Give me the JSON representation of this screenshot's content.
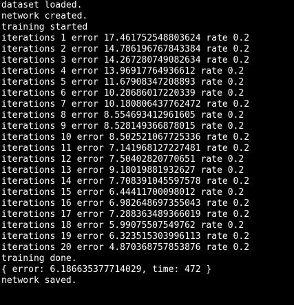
{
  "terminal": {
    "background": "#000000",
    "foreground": "#ffffff",
    "lines": [
      "dataset loaded.",
      "network created.",
      "training started",
      "iterations 1 error 17.461752548803624 rate 0.2",
      "iterations 2 error 14.786196767843384 rate 0.2",
      "iterations 3 error 14.267280749082634 rate 0.2",
      "iterations 4 error 13.96917764936612 rate 0.2",
      "iterations 5 error 11.67908347208893 rate 0.2",
      "iterations 6 error 10.28686017220339 rate 0.2",
      "iterations 7 error 10.180806437762472 rate 0.2",
      "iterations 8 error 8.554693412961605 rate 0.2",
      "iterations 9 error 8.528149366878015 rate 0.2",
      "iterations 10 error 8.502521067725336 rate 0.2",
      "iterations 11 error 7.141968127227481 rate 0.2",
      "iterations 12 error 7.50402820770651 rate 0.2",
      "iterations 13 error 9.18019881932627 rate 0.2",
      "iterations 14 error 7.708391045597578 rate 0.2",
      "iterations 15 error 6.44411700098012 rate 0.2",
      "iterations 16 error 6.982648697355043 rate 0.2",
      "iterations 17 error 7.288363489366019 rate 0.2",
      "iterations 18 error 5.99075507549762 rate 0.2",
      "iterations 19 error 6.323515303996113 rate 0.2",
      "iterations 20 error 4.870368757853876 rate 0.2",
      "training done.",
      "{ error: 6.186635377714029, time: 472 }",
      "network saved."
    ]
  }
}
